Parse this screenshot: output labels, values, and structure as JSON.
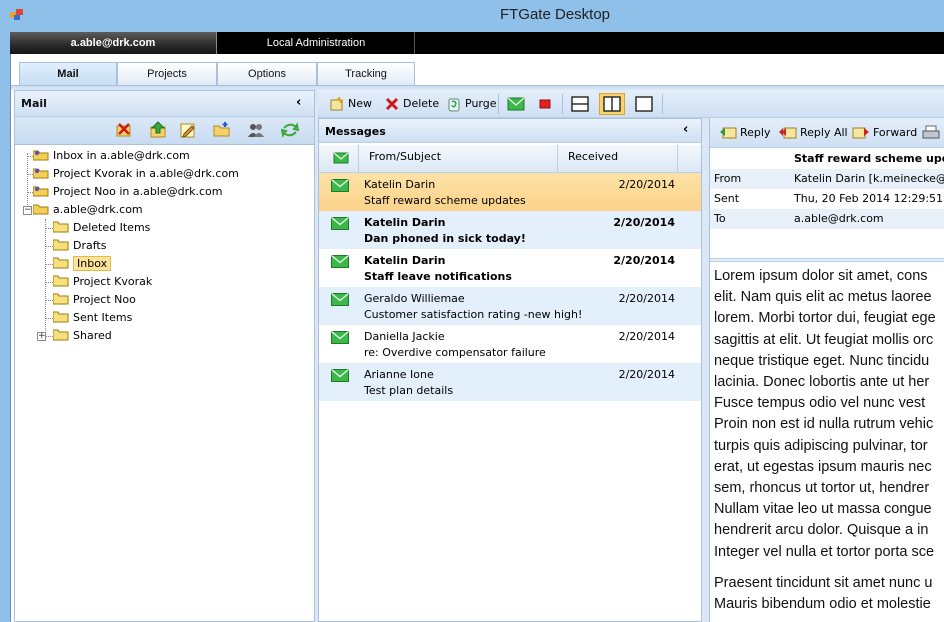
{
  "window": {
    "title": "FTGate Desktop"
  },
  "accounts": {
    "tabs": [
      "a.able@drk.com",
      "Local Administration"
    ]
  },
  "nav": {
    "tabs": [
      "Mail",
      "Projects",
      "Options",
      "Tracking"
    ],
    "active": "Mail"
  },
  "left_pane": {
    "title": "Mail",
    "collapse": "‹",
    "toolbar_icons": [
      "delete-folder-icon",
      "move-up-icon",
      "edit-icon",
      "new-folder-icon",
      "users-icon",
      "refresh-icon"
    ],
    "tree": {
      "shared_mailboxes": [
        "Inbox in a.able@drk.com",
        "Project Kvorak in a.able@drk.com",
        "Project Noo in a.able@drk.com"
      ],
      "account": "a.able@drk.com",
      "folders": [
        "Deleted Items",
        "Drafts",
        "Inbox",
        "Project Kvorak",
        "Project Noo",
        "Sent Items",
        "Shared"
      ],
      "selected": "Inbox"
    }
  },
  "actions": {
    "new": "New",
    "delete": "Delete",
    "purge": "Purge"
  },
  "messages": {
    "title": "Messages",
    "collapse": "‹",
    "columns": [
      "From/Subject",
      "Received"
    ],
    "rows": [
      {
        "from": "Katelin Darin",
        "subject": "Staff reward scheme updates",
        "date": "2/20/2014",
        "unread": false,
        "selected": true
      },
      {
        "from": "Katelin Darin",
        "subject": "Dan phoned in sick today!",
        "date": "2/20/2014",
        "unread": true,
        "selected": false
      },
      {
        "from": "Katelin Darin",
        "subject": "Staff leave notifications",
        "date": "2/20/2014",
        "unread": true,
        "selected": false
      },
      {
        "from": "Geraldo Williemae",
        "subject": "Customer satisfaction rating -new high!",
        "date": "2/20/2014",
        "unread": false,
        "selected": false
      },
      {
        "from": "Daniella Jackie",
        "subject": "re: Overdive compensator failure",
        "date": "2/20/2014",
        "unread": false,
        "selected": false
      },
      {
        "from": "Arianne Ione",
        "subject": "Test plan details",
        "date": "2/20/2014",
        "unread": false,
        "selected": false
      }
    ]
  },
  "reading": {
    "reply": "Reply",
    "reply_all": "Reply All",
    "forward": "Forward",
    "subject": "Staff reward scheme upda",
    "from_label": "From",
    "from_value": "Katelin Darin  [k.meinecke@drk",
    "sent_label": "Sent",
    "sent_value": "Thu, 20 Feb 2014 12:29:51",
    "to_label": "To",
    "to_value": "a.able@drk.com",
    "body_lines": [
      "Lorem ipsum dolor sit amet, cons",
      "elit. Nam quis elit ac metus laoree",
      "lorem. Morbi tortor dui, feugiat ege",
      "sagittis at elit. Ut feugiat mollis orc",
      "neque tristique eget. Nunc tincidu",
      "lacinia. Donec lobortis ante ut her",
      "Fusce tempus odio vel nunc vest",
      "Proin non est id nulla rutrum vehic",
      "turpis quis adipiscing pulvinar, tor",
      "erat, ut egestas ipsum mauris nec",
      "sem, rhoncus ut tortor ut, hendrer",
      "Nullam vitae leo ut massa congue",
      "hendrerit arcu dolor. Quisque a in",
      "Integer vel nulla et tortor porta sce",
      "",
      "Praesent tincidunt sit amet nunc u",
      "Mauris bibendum odio et molestie"
    ]
  },
  "colors": {
    "selected_row": "#fdd895",
    "alt_row": "#e3effb",
    "chrome": "#8fc0ea"
  }
}
